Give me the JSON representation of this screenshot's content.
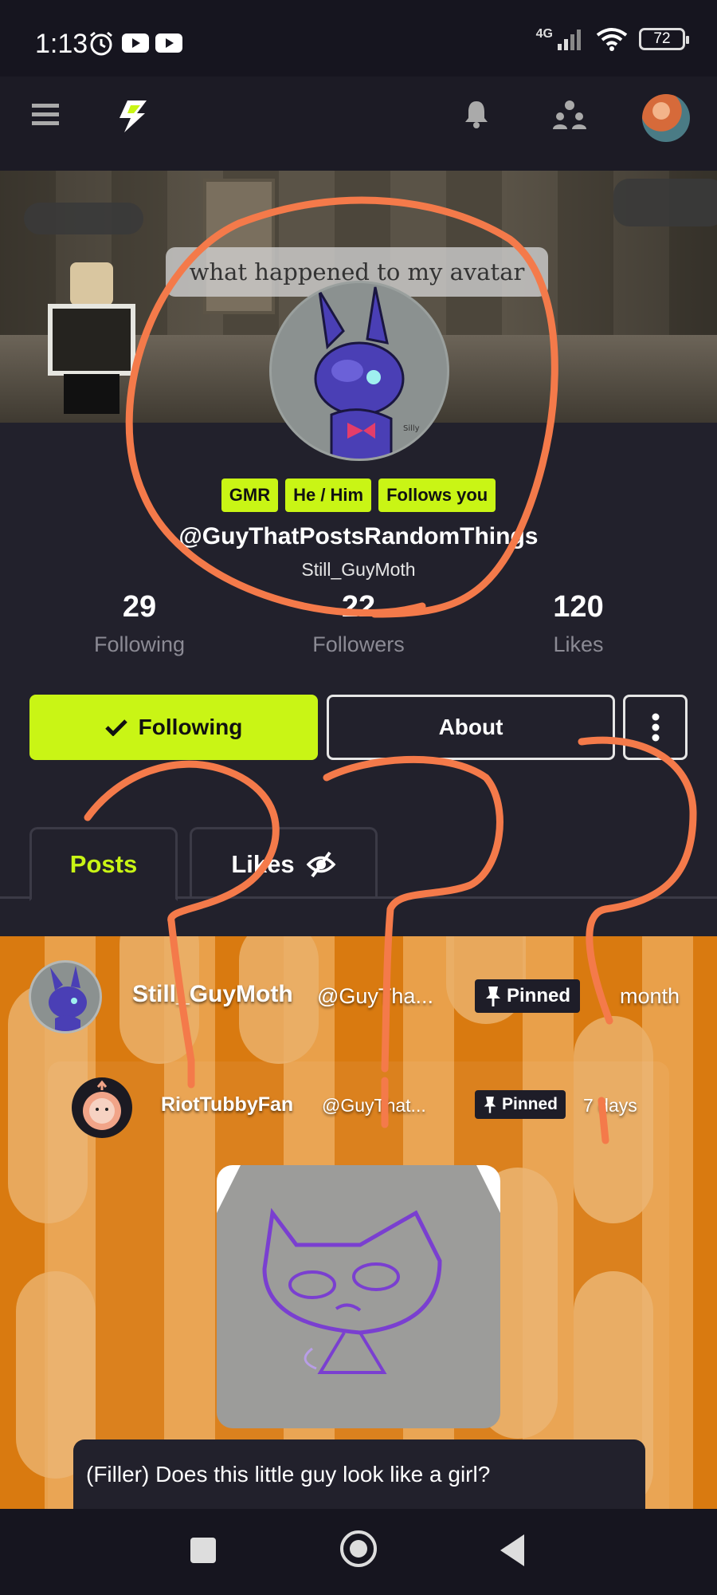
{
  "status_bar": {
    "time": "1:13",
    "network": "4G",
    "battery": "72",
    "icons": [
      "alarm-icon",
      "youtube-icon",
      "youtube-icon",
      "signal-icon",
      "wifi-icon",
      "battery-icon"
    ]
  },
  "app_bar": {
    "icons": [
      "menu-icon",
      "app-logo-icon",
      "bell-icon",
      "people-icon",
      "user-avatar"
    ]
  },
  "banner": {
    "speech_text": "what happened to my avatar"
  },
  "profile": {
    "tags": [
      "GMR",
      "He / Him",
      "Follows you"
    ],
    "handle": "@GuyThatPostsRandomThings",
    "username": "Still_GuyMoth",
    "stats": {
      "following": {
        "value": "29",
        "label": "Following"
      },
      "followers": {
        "value": "22",
        "label": "Followers"
      },
      "likes": {
        "value": "120",
        "label": "Likes"
      }
    }
  },
  "actions": {
    "following_label": "Following",
    "about_label": "About"
  },
  "tabs": {
    "posts": "Posts",
    "likes": "Likes"
  },
  "post": {
    "author_name": "Still_GuyMoth",
    "author_handle": "@GuyTha...",
    "pinned_label": "Pinned",
    "time": "month",
    "quoted": {
      "author_name": "RiotTubbyFan",
      "author_handle": "@GuyThat...",
      "pinned_label": "Pinned",
      "time": "7 days"
    },
    "caption": "(Filler) Does this little guy look like a girl?"
  },
  "colors": {
    "accent": "#c9f515",
    "background": "#22212c",
    "annotation": "#f47a4a"
  }
}
